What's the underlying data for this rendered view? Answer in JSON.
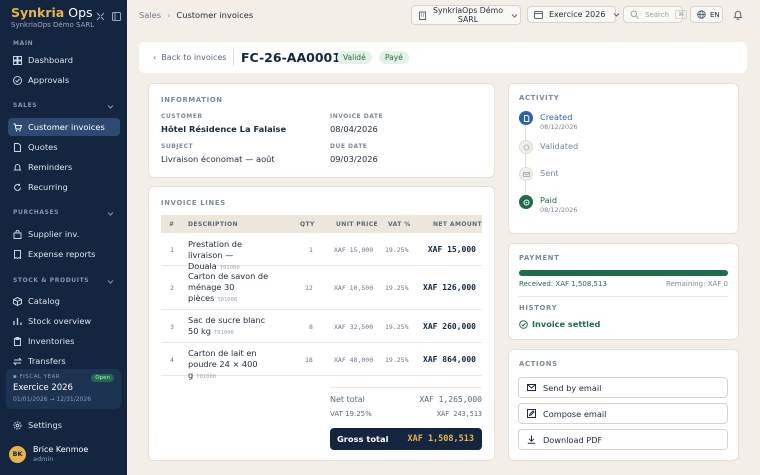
{
  "sidebar": {
    "brand_main": "Synkria",
    "brand_accent": "Ops",
    "brand_sub": "SynkriaOps Démo SARL",
    "sections": {
      "main": "MAIN",
      "sales": "SALES",
      "purchases": "PURCHASES",
      "stock": "STOCK & PRODUITS"
    },
    "items": {
      "dashboard": "Dashboard",
      "approvals": "Approvals",
      "customer_invoices": "Customer invoices",
      "quotes": "Quotes",
      "reminders": "Reminders",
      "recurring": "Recurring",
      "supplier_inv": "Supplier inv.",
      "expense_reports": "Expense reports",
      "catalog": "Catalog",
      "stock_overview": "Stock overview",
      "inventories": "Inventories",
      "transfers": "Transfers",
      "settings": "Settings"
    },
    "fiscal": {
      "label": "FISCAL YEAR",
      "status": "Open",
      "year": "Exercice 2026",
      "dates": "01/01/2026 → 12/31/2026"
    },
    "user": {
      "initials": "BK",
      "name": "Brice Kenmoe",
      "role": "admin"
    }
  },
  "topbar": {
    "breadcrumb_parent": "Sales",
    "breadcrumb_sep": "›",
    "breadcrumb_current": "Customer invoices",
    "company_line1": "SynkriaOps Démo",
    "company_line2": "SARL",
    "fiscal_year": "Exercice 2026",
    "search_placeholder": "Search",
    "search_shortcut": "⌘",
    "language": "EN"
  },
  "header": {
    "back_label": "Back to invoices",
    "invoice_number": "FC-26-AA00012",
    "status_validated": "Validé",
    "status_paid": "Payé"
  },
  "information": {
    "title": "INFORMATION",
    "customer_label": "CUSTOMER",
    "customer": "Hôtel Résidence La Falaise",
    "invoice_date_label": "INVOICE DATE",
    "invoice_date": "08/04/2026",
    "subject_label": "SUBJECT",
    "subject": "Livraison économat — août",
    "due_date_label": "DUE DATE",
    "due_date": "09/03/2026"
  },
  "lines": {
    "title": "INVOICE LINES",
    "columns": {
      "num": "#",
      "description": "DESCRIPTION",
      "qty": "QTY",
      "unit_price": "UNIT PRICE",
      "vat": "VAT %",
      "net": "NET AMOUNT"
    },
    "rows": [
      {
        "num": "1",
        "description": "Prestation de livraison — Douala",
        "sku": "T01000",
        "qty": "1",
        "unit_price": "XAF 15,000",
        "vat": "19.25%",
        "net": "XAF 15,000"
      },
      {
        "num": "2",
        "description": "Carton de savon de ménage 30 pièces",
        "sku": "T01000",
        "qty": "12",
        "unit_price": "XAF 10,500",
        "vat": "19.25%",
        "net": "XAF 126,000"
      },
      {
        "num": "3",
        "description": "Sac de sucre blanc 50 kg",
        "sku": "T01000",
        "qty": "8",
        "unit_price": "XAF 32,500",
        "vat": "19.25%",
        "net": "XAF 260,000"
      },
      {
        "num": "4",
        "description": "Carton de lait en poudre 24 × 400 g",
        "sku": "T01000",
        "qty": "18",
        "unit_price": "XAF 48,000",
        "vat": "19.25%",
        "net": "XAF 864,000"
      }
    ],
    "net_total_label": "Net total",
    "net_total": "XAF 1,265,000",
    "vat_label": "VAT 19.25%",
    "vat_total": "XAF 243,513",
    "gross_label": "Gross total",
    "gross_total": "XAF 1,508,513"
  },
  "activity": {
    "title": "ACTIVITY",
    "events": [
      {
        "name": "Created",
        "date": "08/12/2026"
      },
      {
        "name": "Validated",
        "date": ""
      },
      {
        "name": "Sent",
        "date": ""
      },
      {
        "name": "Paid",
        "date": "08/12/2026"
      }
    ]
  },
  "payment": {
    "title": "PAYMENT",
    "progress_percent": 100,
    "received": "Received: XAF 1,508,513",
    "remaining": "Remaining: XAF 0",
    "history_title": "HISTORY",
    "settled": "Invoice settled"
  },
  "actions": {
    "title": "ACTIONS",
    "send_email": "Send by email",
    "compose_email": "Compose email",
    "download_pdf": "Download PDF"
  },
  "colors": {
    "sidebar": "#14253f",
    "accent": "#e8b34a",
    "success": "#1f6b4a",
    "active_nav": "#2f4a72"
  }
}
